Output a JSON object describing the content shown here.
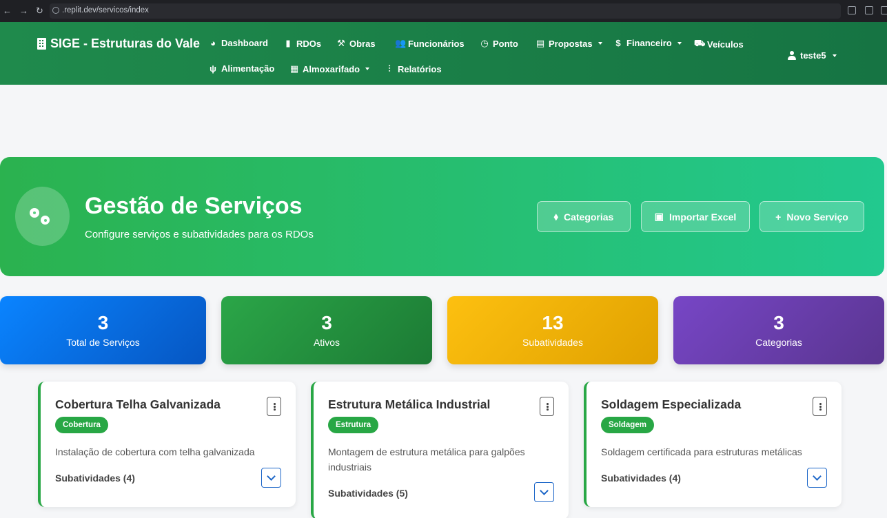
{
  "browser": {
    "url": ".replit.dev/servicos/index",
    "back": "←",
    "forward": "→",
    "reload": "↻"
  },
  "navbar": {
    "brand": "SIGE - Estruturas do Vale",
    "items": [
      {
        "label": "Dashboard",
        "icon": "◕"
      },
      {
        "label": "RDOs",
        "icon": "▮"
      },
      {
        "label": "Obras",
        "icon": "⚒"
      },
      {
        "label": "Funcionários",
        "icon": "👥"
      },
      {
        "label": "Ponto",
        "icon": "◷"
      },
      {
        "label": "Propostas",
        "icon": "▤"
      },
      {
        "label": "Financeiro",
        "icon": "$"
      },
      {
        "label": "Veículos",
        "icon": "⛟"
      },
      {
        "label": "Alimentação",
        "icon": "ψ"
      },
      {
        "label": "Almoxarifado",
        "icon": "▦"
      },
      {
        "label": "Relatórios",
        "icon": "⫶"
      }
    ],
    "user": "teste5"
  },
  "hero": {
    "title": "Gestão de Serviços",
    "subtitle": "Configure serviços e subatividades para os RDOs",
    "buttons": {
      "categorias": {
        "label": "Categorias",
        "icon": "⬧"
      },
      "importar": {
        "label": "Importar Excel",
        "icon": "▣"
      },
      "novo": {
        "label": "Novo Serviço",
        "icon": "+"
      }
    }
  },
  "stats": [
    {
      "value": "3",
      "label": "Total de Serviços"
    },
    {
      "value": "3",
      "label": "Ativos"
    },
    {
      "value": "13",
      "label": "Subatividades"
    },
    {
      "value": "3",
      "label": "Categorias"
    }
  ],
  "services": [
    {
      "title": "Cobertura Telha Galvanizada",
      "category": "Cobertura",
      "description": "Instalação de cobertura com telha galvanizada",
      "subactivities": "Subatividades (4)"
    },
    {
      "title": "Estrutura Metálica Industrial",
      "category": "Estrutura",
      "description": "Montagem de estrutura metálica para galpões industriais",
      "subactivities": "Subatividades (5)"
    },
    {
      "title": "Soldagem Especializada",
      "category": "Soldagem",
      "description": "Soldagem certificada para estruturas metálicas",
      "subactivities": "Subatividades (4)"
    }
  ]
}
